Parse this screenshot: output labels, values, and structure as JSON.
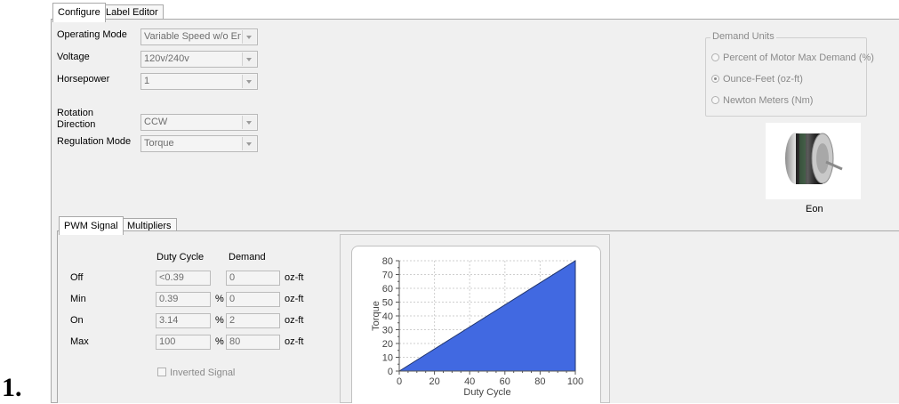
{
  "list_marker": "1.",
  "tabs": [
    {
      "label": "Configure",
      "active": true
    },
    {
      "label": "Label Editor",
      "active": false
    }
  ],
  "config": {
    "operating_mode": {
      "label": "Operating Mode",
      "value": "Variable Speed w/o Enal"
    },
    "voltage": {
      "label": "Voltage",
      "value": "120v/240v"
    },
    "horsepower": {
      "label": "Horsepower",
      "value": "1"
    },
    "rotation_direction": {
      "label_line1": "Rotation",
      "label_line2": "Direction",
      "value": "CCW"
    },
    "regulation_mode": {
      "label": "Regulation Mode",
      "value": "Torque"
    }
  },
  "demand_units": {
    "title": "Demand Units",
    "options": [
      {
        "label": "Percent of Motor Max Demand (%)",
        "selected": false
      },
      {
        "label": "Ounce-Feet (oz-ft)",
        "selected": true
      },
      {
        "label": "Newton Meters (Nm)",
        "selected": false
      }
    ]
  },
  "motor": {
    "caption": "Eon",
    "icon": "motor-icon"
  },
  "sub_tabs": [
    {
      "label": "PWM Signal",
      "active": true
    },
    {
      "label": "Multipliers",
      "active": false
    }
  ],
  "pwm": {
    "headers": {
      "duty_cycle": "Duty Cycle",
      "demand": "Demand"
    },
    "rows": [
      {
        "label": "Off",
        "duty": "<0.39",
        "pct": "",
        "demand": "0",
        "unit": "oz-ft"
      },
      {
        "label": "Min",
        "duty": "0.39",
        "pct": "%",
        "demand": "0",
        "unit": "oz-ft"
      },
      {
        "label": "On",
        "duty": "3.14",
        "pct": "%",
        "demand": "2",
        "unit": "oz-ft"
      },
      {
        "label": "Max",
        "duty": "100",
        "pct": "%",
        "demand": "80",
        "unit": "oz-ft"
      }
    ],
    "inverted_label": "Inverted Signal",
    "inverted_checked": false
  },
  "chart_data": {
    "type": "area",
    "x": [
      0,
      100
    ],
    "y": [
      0,
      80
    ],
    "xlabel": "Duty Cycle",
    "ylabel": "Torque",
    "xlim": [
      0,
      100
    ],
    "ylim": [
      0,
      80
    ],
    "xticks": [
      "0",
      "20",
      "40",
      "60",
      "80",
      "100"
    ],
    "yticks": [
      "0",
      "10",
      "20",
      "30",
      "40",
      "50",
      "60",
      "70",
      "80"
    ],
    "grid": true,
    "fill_color": "#4169e1"
  }
}
